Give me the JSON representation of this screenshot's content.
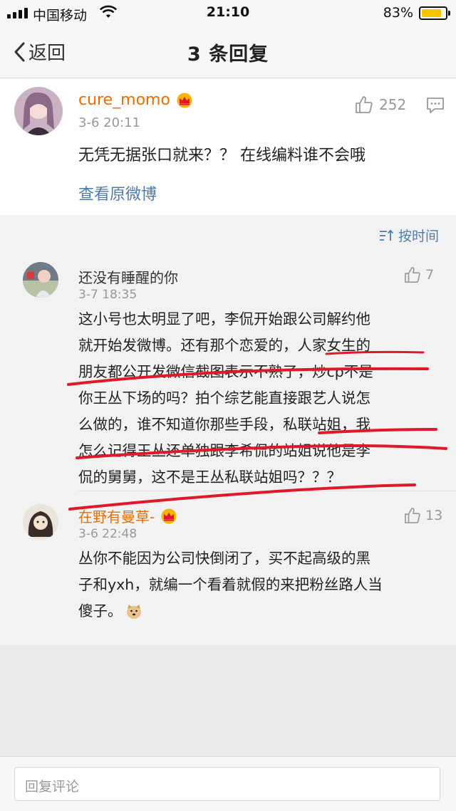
{
  "status": {
    "carrier": "中国移动",
    "time": "21:10",
    "battery": "83%",
    "battery_level": 0.83
  },
  "nav": {
    "back_label": "返回",
    "title": "3 条回复"
  },
  "post": {
    "username": "cure_momo",
    "time": "3-6 20:11",
    "likes": "252",
    "content": "无凭无据张口就来？？ 在线编料谁不会哦",
    "view_original": "查看原微博"
  },
  "sort": {
    "label": "按时间"
  },
  "replies": [
    {
      "username": "还没有睡醒的你",
      "time": "3-7 18:35",
      "likes": "7",
      "lines": [
        "这小号也太明显了吧，李侃开始跟公司解约他",
        "就开始发微博。还有那个恋爱的，人家女生的",
        "朋友都公开发微信截图表示不熟了，炒cp不是",
        "你王丛下场的吗？拍个综艺能直接跟艺人说怎",
        "么做的，谁不知道你那些手段，私联站姐，我",
        "怎么记得王丛还单独跟李希侃的站姐说他是李",
        "侃的舅舅，这不是王丛私联站姐吗？？？"
      ]
    },
    {
      "username": "在野有曼草-",
      "time": "3-6 22:48",
      "likes": "13",
      "lines": [
        "丛你不能因为公司快倒闭了，买不起高级的黑",
        "子和yxh，就编一个看着就假的来把粉丝路人当",
        "傻子。"
      ]
    }
  ],
  "footer": {
    "placeholder": "回复评论"
  },
  "colors": {
    "orange": "#e86e00",
    "link": "#4d7cab",
    "annotation": "#e0192a"
  }
}
